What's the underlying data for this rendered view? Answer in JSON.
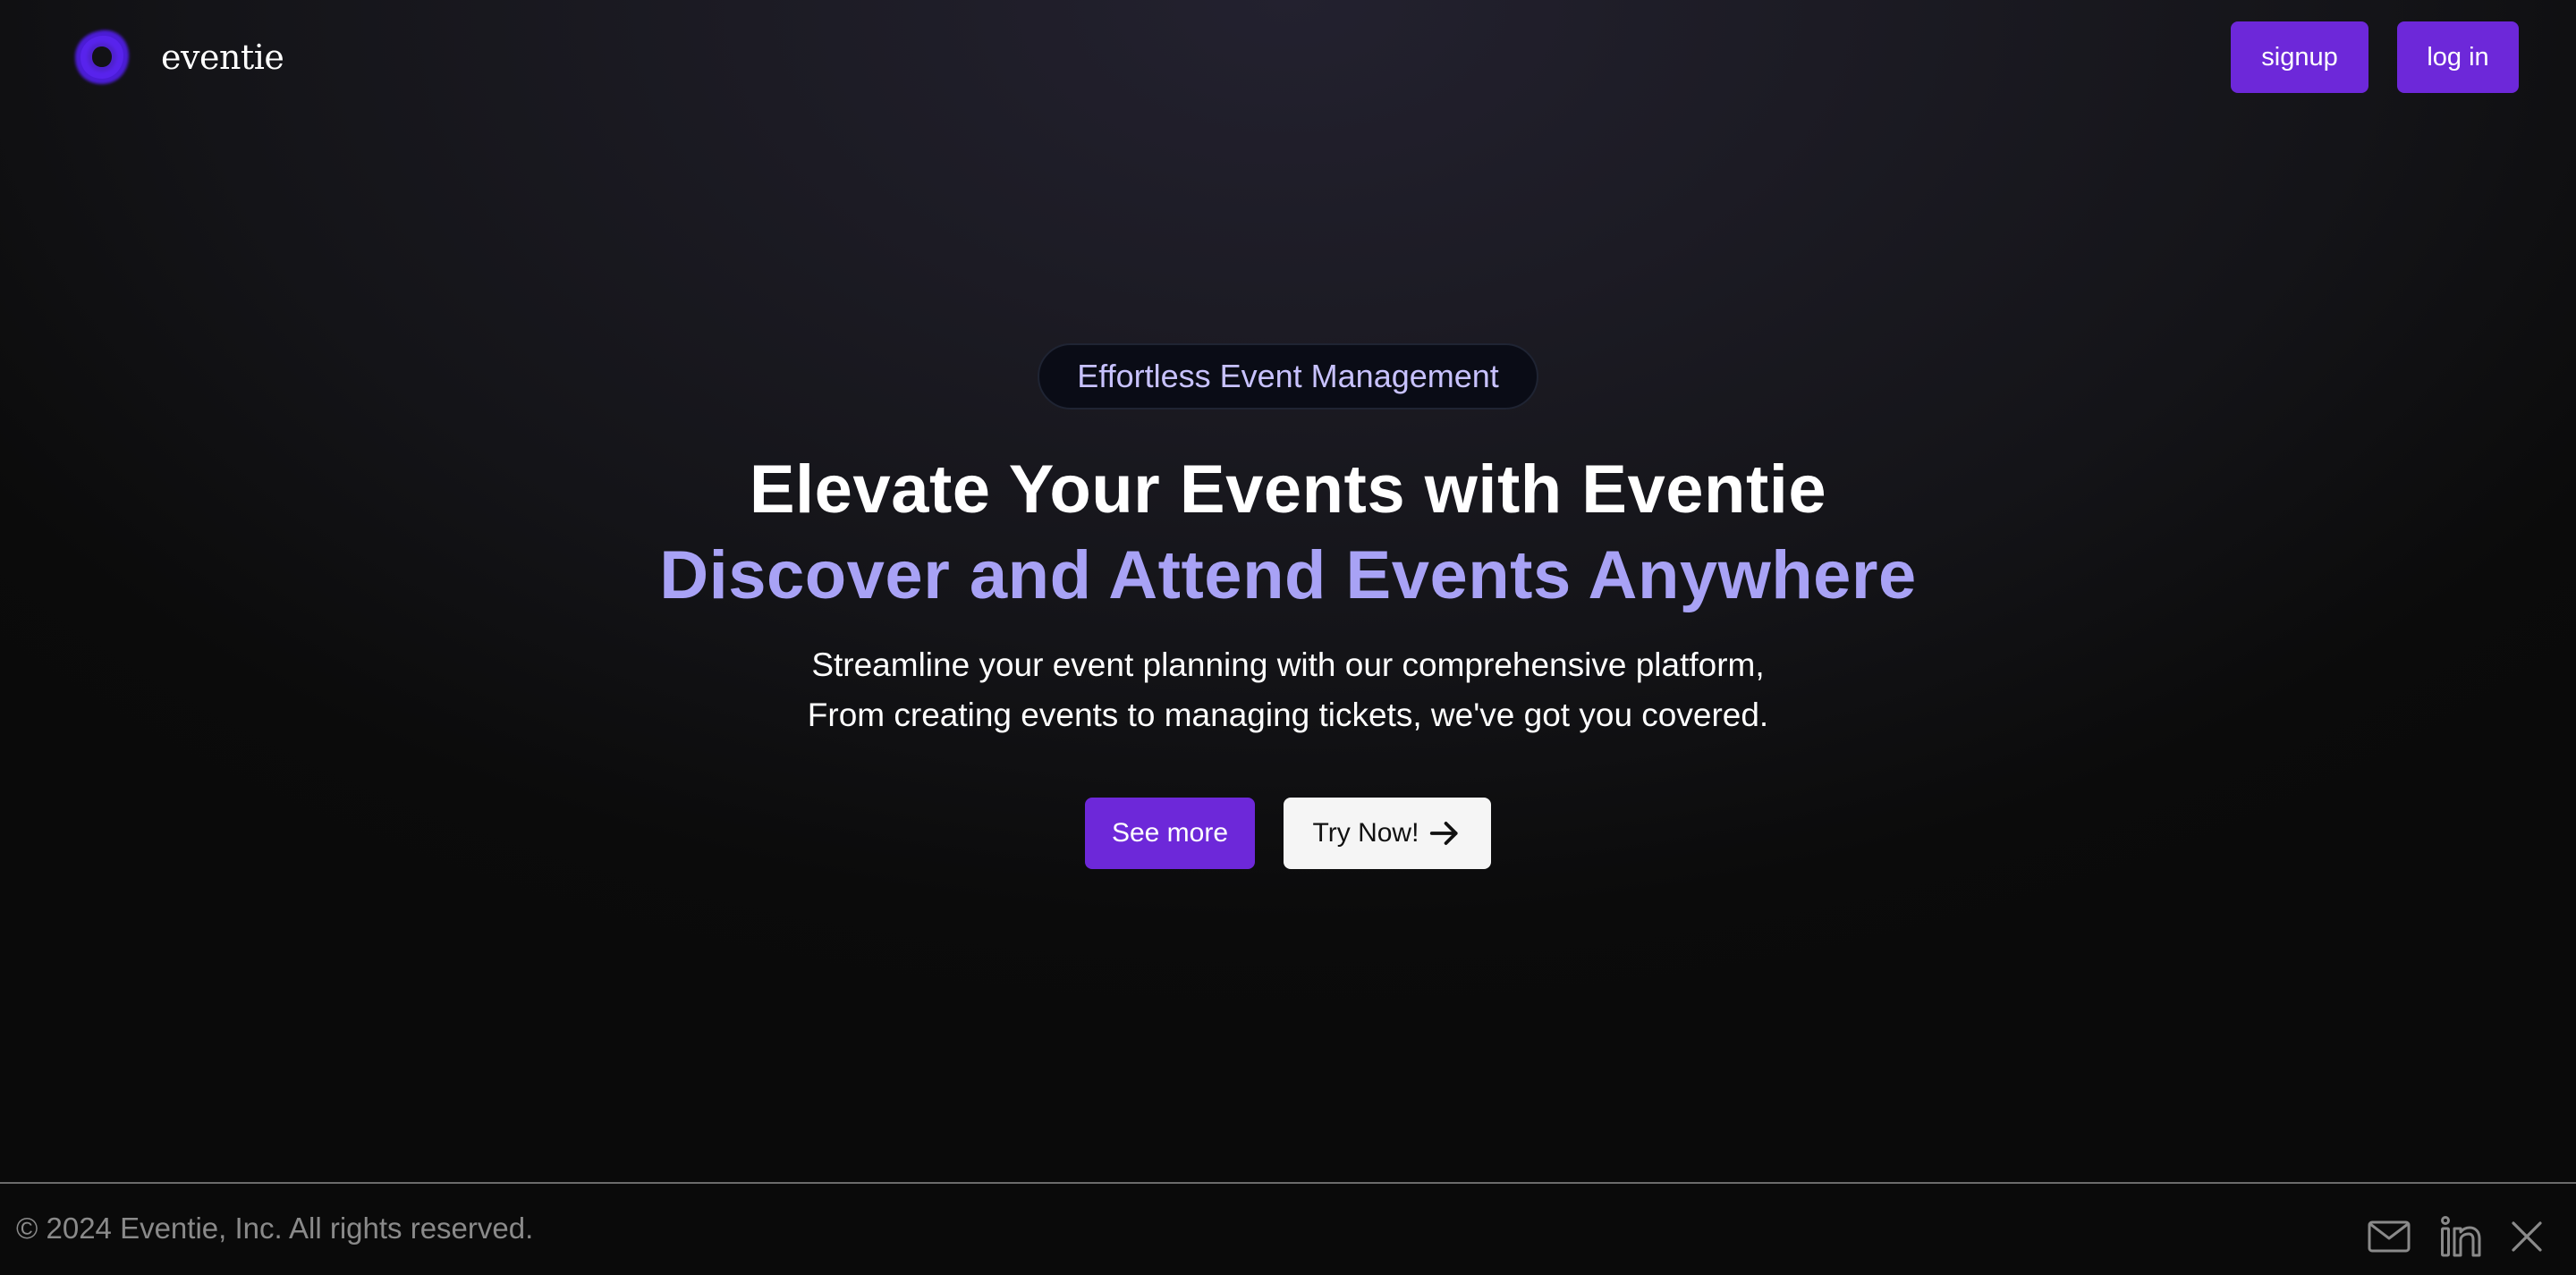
{
  "brand": {
    "name": "eventie",
    "accent_color": "#6d28d9",
    "logo_icon": "ring-logo-icon"
  },
  "nav": {
    "signup_label": "signup",
    "login_label": "log in"
  },
  "hero": {
    "tagline": "Effortless Event Management",
    "headline_1": "Elevate Your Events with Eventie",
    "headline_2": "Discover and Attend Events Anywhere",
    "headline_2_color": "#a8a2f5",
    "subtitle_1": "Streamline your event planning with our comprehensive platform,",
    "subtitle_2": "From creating events to managing tickets, we've got you covered.",
    "see_more_label": "See more",
    "try_now_label": "Try Now!",
    "try_now_icon": "arrow-right-icon"
  },
  "footer": {
    "copyright": "© 2024 Eventie, Inc. All rights reserved.",
    "social_icons": [
      "mail-icon",
      "linkedin-icon",
      "x-icon"
    ]
  }
}
